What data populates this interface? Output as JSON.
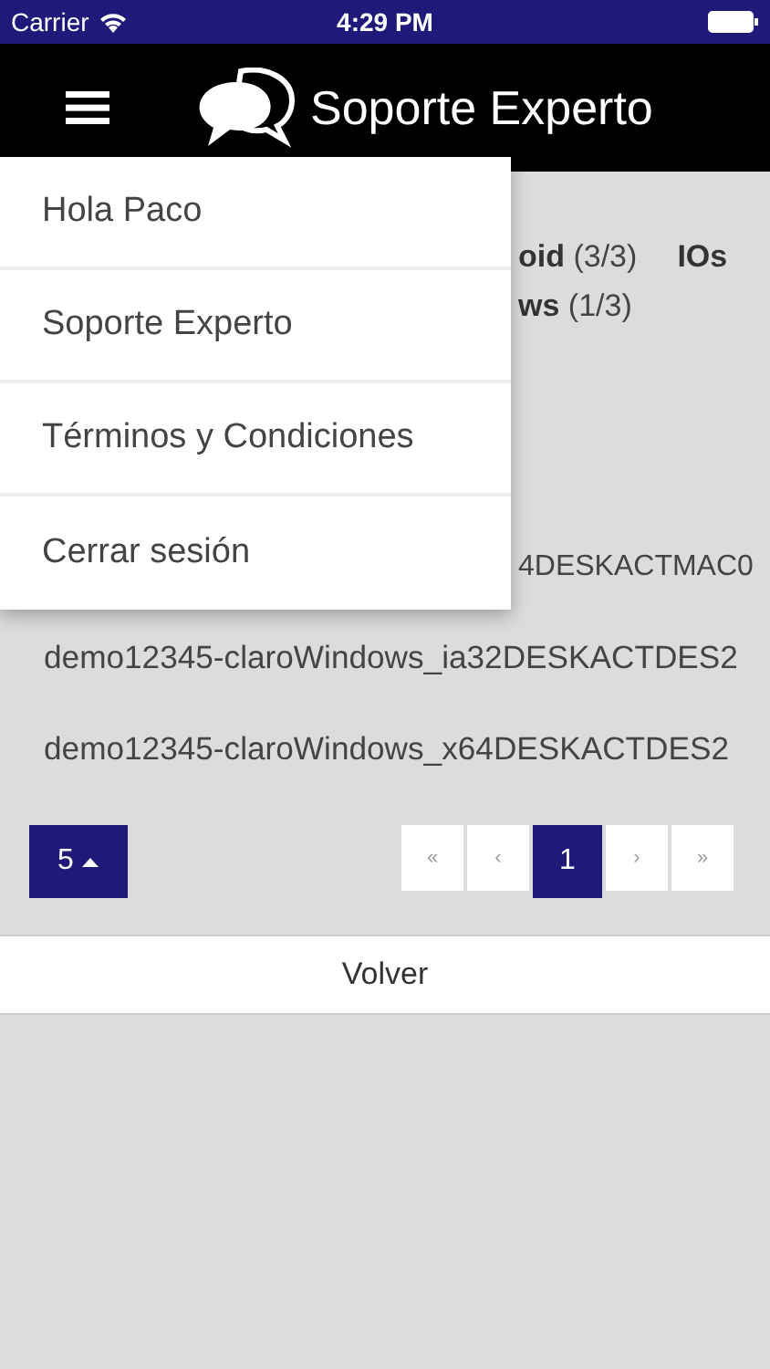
{
  "status_bar": {
    "carrier": "Carrier",
    "time": "4:29 PM"
  },
  "header": {
    "title": "Soporte Experto"
  },
  "stats": [
    {
      "text": "**oid** (3/3)"
    },
    {
      "text": "**IOs**"
    },
    {
      "text": "**ws** (1/3)"
    }
  ],
  "partial_row": "4DESKACTMAC0",
  "rows": [
    "demo12345-claroWindows_ia32DESKACTDES2",
    "demo12345-claroWindows_x64DESKACTDES2"
  ],
  "page_size": "5",
  "pagination": [
    {
      "label": "«",
      "selected": false
    },
    {
      "label": "‹",
      "selected": false
    },
    {
      "label": "1",
      "selected": true
    },
    {
      "label": "›",
      "selected": false
    },
    {
      "label": "»",
      "selected": false
    }
  ],
  "back_button": "Volver",
  "menu": {
    "items": [
      "Hola Paco",
      "Soporte Experto",
      "Términos y Condiciones",
      "Cerrar sesión"
    ]
  }
}
